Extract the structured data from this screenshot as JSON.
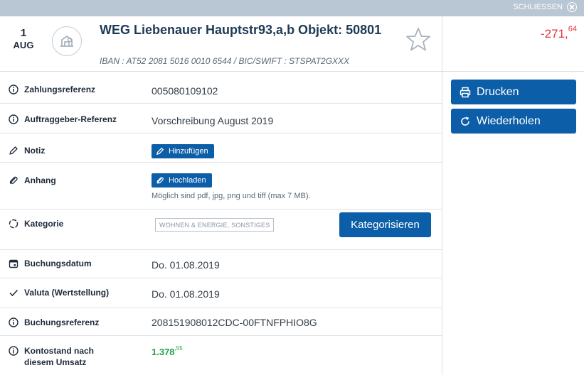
{
  "topbar": {
    "close_label": "SCHLIESSEN"
  },
  "header": {
    "day": "1",
    "month": "AUG",
    "title": "WEG Liebenauer Hauptstr93,a,b Objekt: 50801",
    "iban": "IBAN : AT52 2081 5016 0010 6544 / BIC/SWIFT : STSPAT2GXXX",
    "amount_main": "-271,",
    "amount_cents": "64",
    "amount_color": "#e4363a"
  },
  "rows": {
    "payment_ref": {
      "label": "Zahlungsreferenz",
      "value": "005080109102"
    },
    "client_ref": {
      "label": "Auftraggeber-Referenz",
      "value": "Vorschreibung August 2019"
    },
    "note": {
      "label": "Notiz",
      "button": "Hinzufügen"
    },
    "attachment": {
      "label": "Anhang",
      "button": "Hochladen",
      "hint": "Möglich sind pdf, jpg, png und tiff (max 7 MB)."
    },
    "category": {
      "label": "Kategorie",
      "tag": "WOHNEN & ENERGIE, SONSTIGES",
      "button": "Kategorisieren"
    },
    "booking_date": {
      "label": "Buchungsdatum",
      "value": "Do. 01.08.2019"
    },
    "value_date": {
      "label": "Valuta (Wertstellung)",
      "value": "Do. 01.08.2019"
    },
    "booking_ref": {
      "label": "Buchungsreferenz",
      "value": "208151908012CDC-00FTNFPHIO8G"
    },
    "balance": {
      "label_line1": "Kontostand nach",
      "label_line2": "diesem Umsatz",
      "value_main": "1.378",
      "value_cents": ",55",
      "color": "#23a047"
    }
  },
  "actions": {
    "print": "Drucken",
    "repeat": "Wiederholen"
  },
  "icons": [
    "close-icon",
    "merchant-house-icon",
    "star-icon",
    "info-icon",
    "pencil-icon",
    "paperclip-icon",
    "category-ring-icon",
    "calendar-icon",
    "checkmark-icon",
    "printer-icon",
    "repeat-icon"
  ],
  "colors": {
    "accent": "#0c5ea8",
    "topbar": "#b9c6d3",
    "negative": "#e4363a",
    "positive": "#23a047"
  }
}
